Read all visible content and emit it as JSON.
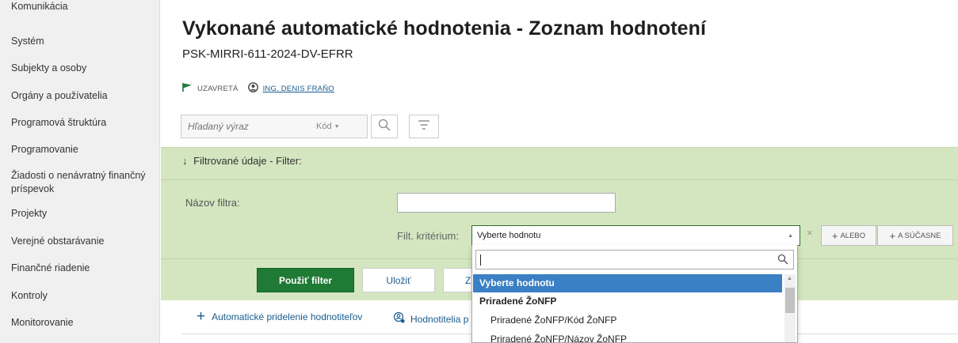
{
  "sidebar": {
    "items": [
      {
        "label": "Komunikácia"
      },
      {
        "label": "Systém"
      },
      {
        "label": "Subjekty a osoby"
      },
      {
        "label": "Orgány a používatelia"
      },
      {
        "label": "Programová štruktúra"
      },
      {
        "label": "Programovanie"
      },
      {
        "label": "Žiadosti o nenávratný finančný"
      },
      {
        "label": "príspevok"
      },
      {
        "label": "Projekty"
      },
      {
        "label": "Verejné obstarávanie"
      },
      {
        "label": "Finančné riadenie"
      },
      {
        "label": "Kontroly"
      },
      {
        "label": "Monitorovanie"
      }
    ]
  },
  "header": {
    "title": "Vykonané automatické hodnotenia - Zoznam hodnotení",
    "subtitle": "PSK-MIRRI-611-2024-DV-EFRR",
    "status": "UZAVRETÁ",
    "user": "ING. DENIS FRAŇO",
    "status_color": "#1f7a35"
  },
  "search": {
    "placeholder": "Hľadaný výraz",
    "field_selector": "Kód"
  },
  "filter": {
    "header": "Filtrované údaje - Filter:",
    "name_label": "Názov filtra:",
    "name_value": "",
    "criterion_label": "Filt. kritérium:",
    "criterion_value": "Vyberte hodnotu",
    "or_label": "ALEBO",
    "and_label": "A SÚČASNE",
    "apply_label": "Použiť filter",
    "save_label": "Uložiť",
    "third_label": "Z"
  },
  "actions": {
    "assign_label": "Automatické pridelenie hodnotiteľov",
    "evaluators_label": "Hodnotitelia p"
  },
  "dropdown": {
    "search_value": "",
    "options": [
      {
        "label": "Vyberte hodnotu",
        "kind": "selected"
      },
      {
        "label": "Priradené ŽoNFP",
        "kind": "group"
      },
      {
        "label": "Priradené ŽoNFP/Kód ŽoNFP",
        "kind": "child"
      },
      {
        "label": "Priradené ŽoNFP/Názov ŽoNFP",
        "kind": "child"
      }
    ]
  },
  "colors": {
    "accent_green": "#1f7a35",
    "filter_panel": "#d4e6c0",
    "link_blue": "#1a5c8e",
    "selection_blue": "#3b7fc4"
  }
}
